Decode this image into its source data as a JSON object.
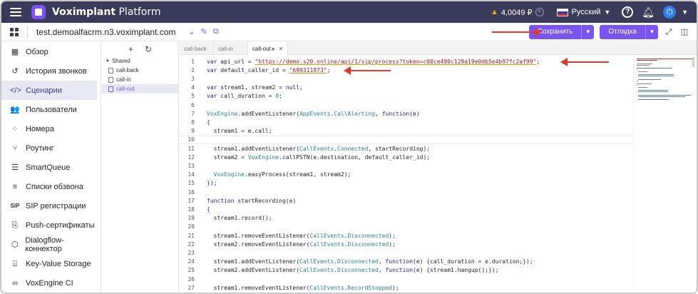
{
  "topbar": {
    "brand_bold": "Voximplant",
    "brand_rest": " Platform",
    "balance": "4,0049 ₽",
    "language": "Русский",
    "help_glyph": "?",
    "power_glyph": "⏻"
  },
  "appbar": {
    "app_name": "test.demoalfacrm.n3.voximplant.com",
    "save_label": "Сохранить",
    "debug_label": "Отладка"
  },
  "sidebar": {
    "items": [
      {
        "label": "Обзор",
        "icon": "dashboard-icon",
        "glyph": "▦",
        "active": false
      },
      {
        "label": "История звонков",
        "icon": "history-icon",
        "glyph": "↺",
        "active": false
      },
      {
        "label": "Сценарии",
        "icon": "code-icon",
        "glyph": "</>",
        "active": true
      },
      {
        "label": "Пользователи",
        "icon": "users-icon",
        "glyph": "👥",
        "active": false
      },
      {
        "label": "Номера",
        "icon": "numbers-icon",
        "glyph": "⁘",
        "active": false
      },
      {
        "label": "Роутинг",
        "icon": "routing-icon",
        "glyph": "⑂",
        "active": false
      },
      {
        "label": "SmartQueue",
        "icon": "queue-icon",
        "glyph": "☰",
        "active": false
      },
      {
        "label": "Списки обзвона",
        "icon": "list-icon",
        "glyph": "≡",
        "active": false
      },
      {
        "label": "SIP регистрации",
        "icon": "sip-icon",
        "glyph": "SIP",
        "active": false
      },
      {
        "label": "Push-сертификаты",
        "icon": "push-icon",
        "glyph": "⎘",
        "active": false
      },
      {
        "label": "Dialogflow-коннектор",
        "icon": "dialogflow-icon",
        "glyph": "⬡",
        "active": false
      },
      {
        "label": "Key-Value Storage",
        "icon": "storage-icon",
        "glyph": "⌸",
        "active": false
      },
      {
        "label": "VoxEngine CI",
        "icon": "ci-icon",
        "glyph": "∞",
        "active": false
      }
    ]
  },
  "tree": {
    "folder": "Shared",
    "files": [
      {
        "name": "call-back",
        "active": false
      },
      {
        "name": "call-in",
        "active": false
      },
      {
        "name": "call-out",
        "active": true
      }
    ]
  },
  "tabs": [
    {
      "label": "call-back",
      "active": false,
      "modified": false
    },
    {
      "label": "call-in",
      "active": false,
      "modified": false
    },
    {
      "label": "call-out",
      "active": true,
      "modified": true
    }
  ],
  "code_lines": [
    {
      "n": "1",
      "text": "var api_url = \"https://demo.s20.online/api/1/sip/process?token=c00ce490c129a19e0db5e4b97fc2af99\";"
    },
    {
      "n": "2",
      "text": "var default_caller_id = \"699311973\";"
    },
    {
      "n": "3",
      "text": ""
    },
    {
      "n": "4",
      "text": "var stream1, stream2 = null;"
    },
    {
      "n": "5",
      "text": "var call_duration = 0;"
    },
    {
      "n": "6",
      "text": ""
    },
    {
      "n": "7",
      "text": "VoxEngine.addEventListener(AppEvents.CallAlerting, function(e)"
    },
    {
      "n": "8",
      "text": "{"
    },
    {
      "n": "9",
      "text": "  stream1 = e.call;"
    },
    {
      "n": "10",
      "text": ""
    },
    {
      "n": "11",
      "text": "  stream1.addEventListener(CallEvents.Connected, startRecording);"
    },
    {
      "n": "12",
      "text": "  stream2 = VoxEngine.callPSTN(e.destination, default_caller_id);"
    },
    {
      "n": "13",
      "text": ""
    },
    {
      "n": "14",
      "text": "  VoxEngine.easyProcess(stream1, stream2);"
    },
    {
      "n": "15",
      "text": "});"
    },
    {
      "n": "16",
      "text": ""
    },
    {
      "n": "17",
      "text": "function startRecording(e)"
    },
    {
      "n": "18",
      "text": "{"
    },
    {
      "n": "19",
      "text": "  stream1.record();"
    },
    {
      "n": "20",
      "text": ""
    },
    {
      "n": "21",
      "text": "  stream1.removeEventListener(CallEvents.Disconnected);"
    },
    {
      "n": "22",
      "text": "  stream2.removeEventListener(CallEvents.Disconnected);"
    },
    {
      "n": "23",
      "text": ""
    },
    {
      "n": "24",
      "text": "  stream1.addEventListener(CallEvents.Disconnected, function(e) {call_duration = e.duration;});"
    },
    {
      "n": "25",
      "text": "  stream2.addEventListener(CallEvents.Disconnected, function(e) {stream1.hangup();});"
    },
    {
      "n": "26",
      "text": ""
    },
    {
      "n": "27",
      "text": "  stream1.removeEventListener(CallEvents.RecordStopped);"
    }
  ],
  "colors": {
    "accent": "#7a53f0",
    "topbar": "#3a3a5a",
    "arrow": "#d83a2e"
  }
}
